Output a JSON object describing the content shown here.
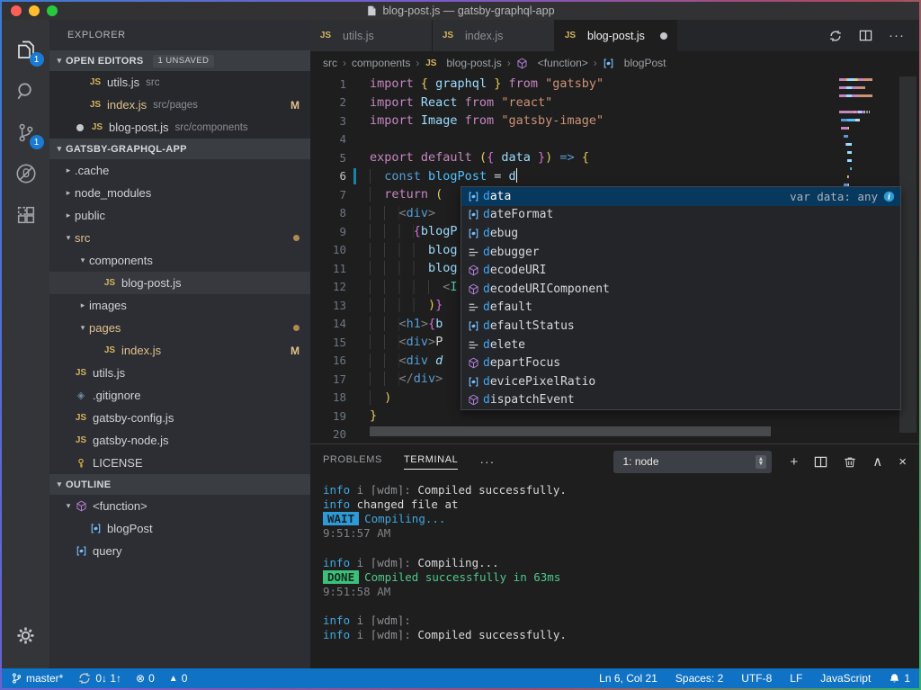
{
  "window": {
    "title": "blog-post.js — gatsby-graphql-app"
  },
  "activity_bar": {
    "items": [
      {
        "icon": "files",
        "name": "explorer",
        "badge": "1"
      },
      {
        "icon": "search",
        "name": "search"
      },
      {
        "icon": "git",
        "name": "source-control",
        "badge": "1"
      },
      {
        "icon": "debug",
        "name": "debug"
      },
      {
        "icon": "extensions",
        "name": "extensions"
      }
    ],
    "bottom": [
      {
        "icon": "gear",
        "name": "settings"
      }
    ]
  },
  "sidebar": {
    "title": "EXPLORER",
    "open_editors": {
      "label": "OPEN EDITORS",
      "badge": "1 UNSAVED",
      "items": [
        {
          "label": "utils.js",
          "desc": "src",
          "dirty": false
        },
        {
          "label": "index.js",
          "desc": "src/pages",
          "gold": true,
          "badge": "M"
        },
        {
          "label": "blog-post.js",
          "desc": "src/components",
          "dirty": true
        }
      ]
    },
    "tree_label": "GATSBY-GRAPHQL-APP",
    "tree": [
      {
        "label": ".cache",
        "depth": 0,
        "twisty": "right"
      },
      {
        "label": "node_modules",
        "depth": 0,
        "twisty": "right"
      },
      {
        "label": "public",
        "depth": 0,
        "twisty": "right"
      },
      {
        "label": "src",
        "depth": 0,
        "twisty": "down",
        "gold": true,
        "dot": true
      },
      {
        "label": "components",
        "depth": 1,
        "twisty": "down"
      },
      {
        "label": "blog-post.js",
        "depth": 2,
        "icon": "js",
        "selected": true
      },
      {
        "label": "images",
        "depth": 1,
        "twisty": "right"
      },
      {
        "label": "pages",
        "depth": 1,
        "twisty": "down",
        "gold": true,
        "dot": true
      },
      {
        "label": "index.js",
        "depth": 2,
        "icon": "js",
        "gold": true,
        "badge": "M"
      },
      {
        "label": "utils.js",
        "depth": 0,
        "icon": "js"
      },
      {
        "label": ".gitignore",
        "depth": 0,
        "icon": "diamond"
      },
      {
        "label": "gatsby-config.js",
        "depth": 0,
        "icon": "js"
      },
      {
        "label": "gatsby-node.js",
        "depth": 0,
        "icon": "js"
      },
      {
        "label": "LICENSE",
        "depth": 0,
        "icon": "key"
      }
    ],
    "outline_label": "OUTLINE",
    "outline": [
      {
        "label": "<function>",
        "depth": 0,
        "twisty": "down",
        "icon": "cube"
      },
      {
        "label": "blogPost",
        "depth": 1,
        "icon": "field"
      },
      {
        "label": "query",
        "depth": 0,
        "icon": "field"
      }
    ]
  },
  "tabs": [
    {
      "label": "utils.js",
      "active": false,
      "dirty": false
    },
    {
      "label": "index.js",
      "active": false,
      "dirty": false
    },
    {
      "label": "blog-post.js",
      "active": true,
      "dirty": true
    }
  ],
  "tab_actions": [
    {
      "icon": "sync",
      "name": "sync"
    },
    {
      "icon": "split",
      "name": "split-editor"
    },
    {
      "text": "···",
      "name": "more-actions"
    }
  ],
  "breadcrumb": [
    {
      "label": "src"
    },
    {
      "label": "components"
    },
    {
      "label": "blog-post.js",
      "icon": "js"
    },
    {
      "label": "<function>",
      "icon": "cube"
    },
    {
      "label": "blogPost",
      "icon": "field"
    }
  ],
  "editor": {
    "lines": [
      {
        "n": 1,
        "t": [
          [
            "kw",
            "import "
          ],
          [
            "b1",
            "{ "
          ],
          [
            "v",
            "graphql"
          ],
          [
            "b1",
            " }"
          ],
          [
            "kw",
            " from "
          ],
          [
            "s",
            "\"gatsby\""
          ]
        ]
      },
      {
        "n": 2,
        "t": [
          [
            "kw",
            "import "
          ],
          [
            "v",
            "React"
          ],
          [
            "kw",
            " from "
          ],
          [
            "s",
            "\"react\""
          ]
        ]
      },
      {
        "n": 3,
        "t": [
          [
            "kw",
            "import "
          ],
          [
            "v",
            "Image"
          ],
          [
            "kw",
            " from "
          ],
          [
            "s",
            "\"gatsby-image\""
          ]
        ]
      },
      {
        "n": 4,
        "t": []
      },
      {
        "n": 5,
        "t": [
          [
            "kw",
            "export "
          ],
          [
            "kw",
            "default "
          ],
          [
            "b1",
            "("
          ],
          [
            "b2",
            "{ "
          ],
          [
            "v",
            "data"
          ],
          [
            "b2",
            " }"
          ],
          [
            "b1",
            ")"
          ],
          [
            "p",
            " "
          ],
          [
            "k2",
            "=>"
          ],
          [
            "p",
            " "
          ],
          [
            "b1",
            "{"
          ]
        ]
      },
      {
        "n": 6,
        "t": [
          [
            "p",
            "  "
          ],
          [
            "k2",
            "const "
          ],
          [
            "cv",
            "blogPost"
          ],
          [
            "p",
            " = "
          ],
          [
            "v",
            "d"
          ]
        ],
        "cursor": true,
        "modified": true,
        "active": true
      },
      {
        "n": 7,
        "t": [
          [
            "p",
            "  "
          ],
          [
            "kw",
            "return "
          ],
          [
            "b1",
            "("
          ]
        ]
      },
      {
        "n": 8,
        "t": [
          [
            "p",
            "    "
          ],
          [
            "tb",
            "<"
          ],
          [
            "tag",
            "div"
          ],
          [
            "tb",
            ">"
          ]
        ]
      },
      {
        "n": 9,
        "t": [
          [
            "p",
            "      "
          ],
          [
            "b2",
            "{"
          ],
          [
            "v",
            "blogP"
          ]
        ]
      },
      {
        "n": 10,
        "t": [
          [
            "p",
            "        "
          ],
          [
            "v",
            "blog"
          ]
        ]
      },
      {
        "n": 11,
        "t": [
          [
            "p",
            "        "
          ],
          [
            "v",
            "blog"
          ]
        ]
      },
      {
        "n": 12,
        "t": [
          [
            "p",
            "          "
          ],
          [
            "tb",
            "<"
          ],
          [
            "comp",
            "I"
          ]
        ]
      },
      {
        "n": 13,
        "t": [
          [
            "p",
            "        "
          ],
          [
            "b1",
            ")"
          ],
          [
            "b2",
            "}"
          ]
        ]
      },
      {
        "n": 14,
        "t": [
          [
            "p",
            "    "
          ],
          [
            "tb",
            "<"
          ],
          [
            "tag",
            "h1"
          ],
          [
            "tb",
            ">"
          ],
          [
            "b2",
            "{"
          ],
          [
            "v",
            "b"
          ]
        ]
      },
      {
        "n": 15,
        "t": [
          [
            "p",
            "    "
          ],
          [
            "tb",
            "<"
          ],
          [
            "tag",
            "div"
          ],
          [
            "tb",
            ">"
          ],
          [
            "p",
            "P"
          ]
        ]
      },
      {
        "n": 16,
        "t": [
          [
            "p",
            "    "
          ],
          [
            "tb",
            "<"
          ],
          [
            "tag",
            "div "
          ],
          [
            "attr",
            "d"
          ]
        ]
      },
      {
        "n": 17,
        "t": [
          [
            "p",
            "    "
          ],
          [
            "tb",
            "</"
          ],
          [
            "tag",
            "div"
          ],
          [
            "tb",
            ">"
          ]
        ]
      },
      {
        "n": 18,
        "t": [
          [
            "p",
            "  "
          ],
          [
            "b1",
            ")"
          ]
        ]
      },
      {
        "n": 19,
        "t": [
          [
            "b1",
            "}"
          ]
        ]
      },
      {
        "n": 20,
        "t": []
      }
    ]
  },
  "suggest": {
    "selected_detail": "var data: any",
    "items": [
      {
        "label": "data",
        "icon": "field",
        "selected": true
      },
      {
        "label": "dateFormat",
        "icon": "field"
      },
      {
        "label": "debug",
        "icon": "field"
      },
      {
        "label": "debugger",
        "icon": "keyword"
      },
      {
        "label": "decodeURI",
        "icon": "cube"
      },
      {
        "label": "decodeURIComponent",
        "icon": "cube"
      },
      {
        "label": "default",
        "icon": "keyword"
      },
      {
        "label": "defaultStatus",
        "icon": "field"
      },
      {
        "label": "delete",
        "icon": "keyword"
      },
      {
        "label": "departFocus",
        "icon": "cube"
      },
      {
        "label": "devicePixelRatio",
        "icon": "field"
      },
      {
        "label": "dispatchEvent",
        "icon": "cube"
      }
    ]
  },
  "terminal": {
    "tabs": [
      {
        "label": "PROBLEMS",
        "active": false
      },
      {
        "label": "TERMINAL",
        "active": true
      }
    ],
    "more": "···",
    "select_value": "1: node",
    "actions": [
      {
        "name": "new-terminal",
        "text": "+"
      },
      {
        "name": "split-terminal",
        "icon": "split"
      },
      {
        "name": "kill-terminal",
        "icon": "trash"
      },
      {
        "name": "maximize-panel",
        "text": "∧"
      },
      {
        "name": "close-panel",
        "text": "×"
      }
    ],
    "lines": [
      [
        [
          "t-blue",
          "info"
        ],
        [
          "t-gray",
          " i ⌈wdm⌉: "
        ],
        [
          "t-white",
          "Compiled successfully."
        ]
      ],
      [
        [
          "t-blue",
          "info"
        ],
        [
          "t-white",
          " changed file at"
        ]
      ],
      [
        [
          "t-badge-blue",
          "WAIT"
        ],
        [
          "t-blue",
          "Compiling..."
        ]
      ],
      [
        [
          "t-dim",
          "9:51:57 AM"
        ]
      ],
      [],
      [
        [
          "t-blue",
          "info"
        ],
        [
          "t-gray",
          " i ⌈wdm⌉: "
        ],
        [
          "t-white",
          "Compiling..."
        ]
      ],
      [
        [
          "t-badge-green",
          "DONE"
        ],
        [
          "t-green",
          "Compiled successfully in 63ms"
        ]
      ],
      [
        [
          "t-dim",
          "9:51:58 AM"
        ]
      ],
      [],
      [
        [
          "t-blue",
          "info"
        ],
        [
          "t-gray",
          " i ⌈wdm⌉:"
        ]
      ],
      [
        [
          "t-blue",
          "info"
        ],
        [
          "t-gray",
          " i ⌈wdm⌉: "
        ],
        [
          "t-white",
          "Compiled successfully."
        ]
      ]
    ]
  },
  "status_bar": {
    "left": [
      {
        "icon": "branch",
        "label": "master*",
        "name": "git-branch"
      },
      {
        "icon": "sync",
        "label": "0↓ 1↑",
        "name": "sync-changes"
      },
      {
        "icon": "error",
        "label": "0",
        "name": "errors"
      },
      {
        "icon": "warn",
        "label": "0",
        "name": "warnings"
      }
    ],
    "right": [
      {
        "label": "Ln 6, Col 21",
        "name": "cursor-position"
      },
      {
        "label": "Spaces: 2",
        "name": "indentation"
      },
      {
        "label": "UTF-8",
        "name": "encoding"
      },
      {
        "label": "LF",
        "name": "eol"
      },
      {
        "label": "JavaScript",
        "name": "language-mode"
      },
      {
        "icon": "bell",
        "label": "1",
        "name": "notifications"
      }
    ]
  },
  "colors": {
    "accent_blue": "#0f72c4",
    "git_modified": "#E2C08D",
    "badge_blue": "#1a7ad4",
    "suggest_selected": "#07395e",
    "done_green": "#3BC17A",
    "wait_blue": "#2E9BD6"
  }
}
